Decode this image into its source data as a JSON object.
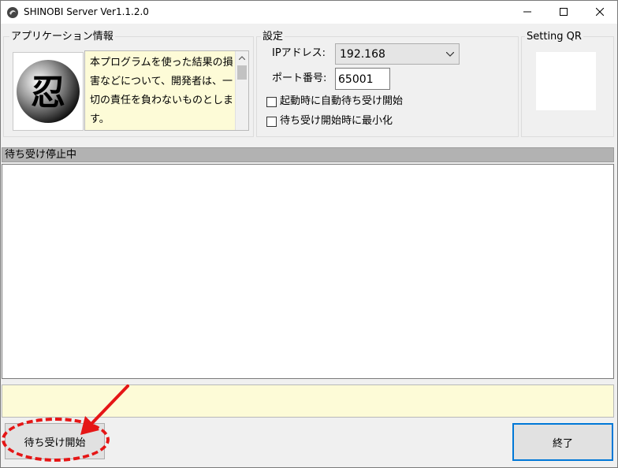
{
  "window": {
    "title": "SHINOBI Server Ver1.1.2.0",
    "minimize_glyph": "—",
    "maximize_glyph": "☐",
    "close_glyph": "✕"
  },
  "app_info": {
    "group_label": "アプリケーション情報",
    "logo_text": "忍",
    "disclaimer": "本プログラムを使った結果の損害などについて、開発者は、一切の責任を負わないものとします。"
  },
  "settings": {
    "group_label": "設定",
    "ip_label": "IPアドレス:",
    "ip_value": "192.168",
    "port_label": "ポート番号:",
    "port_value": "65001",
    "autostart_label": "起動時に自動待ち受け開始",
    "autostart_checked": false,
    "minimize_label": "待ち受け開始時に最小化",
    "minimize_checked": false
  },
  "qr": {
    "group_label": "Setting QR"
  },
  "status": {
    "text": "待ち受け停止中"
  },
  "buttons": {
    "start_label": "待ち受け開始",
    "exit_label": "終了"
  },
  "colors": {
    "annotation": "#e51616",
    "focus_border": "#0078d7",
    "note_bg": "#fdfbd7"
  }
}
